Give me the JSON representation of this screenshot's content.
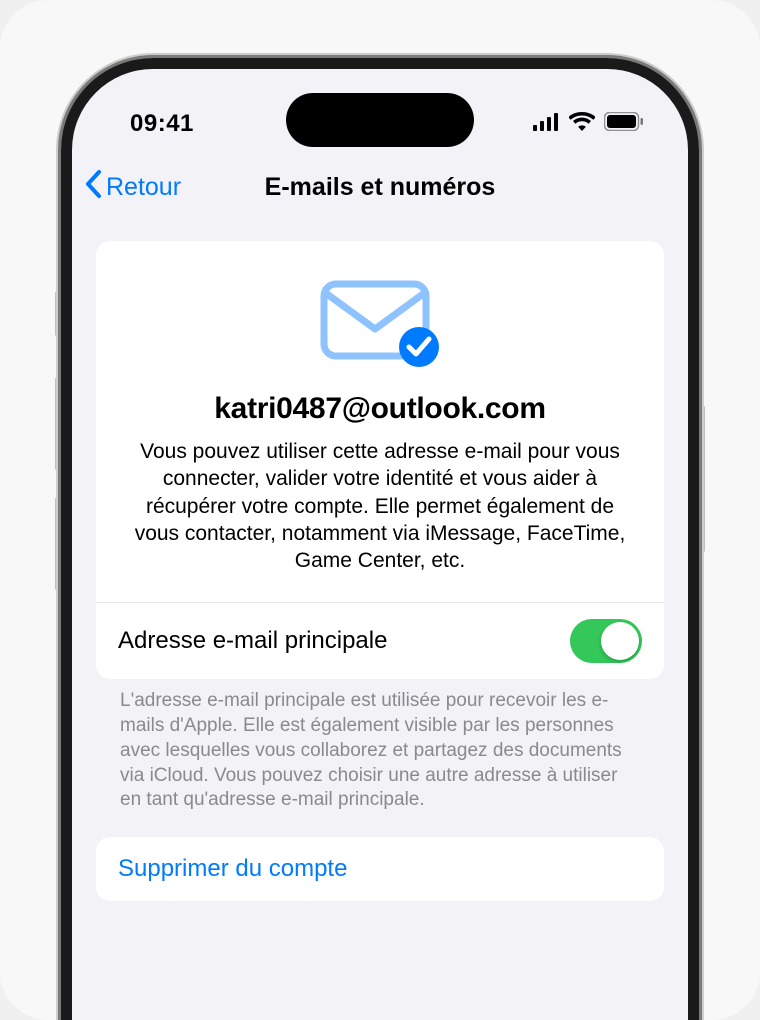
{
  "status": {
    "time": "09:41"
  },
  "nav": {
    "back_label": "Retour",
    "title": "E-mails et numéros"
  },
  "hero": {
    "email": "katri0487@outlook.com",
    "description": "Vous pouvez utiliser cette adresse e-mail pour vous connecter, valider votre identité et vous aider à récupérer votre compte. Elle permet également de vous contacter, notamment via iMessage, FaceTime, Game Center, etc."
  },
  "primary": {
    "label": "Adresse e-mail principale",
    "enabled": true,
    "footer": "L'adresse e-mail principale est utilisée pour recevoir les e-mails d'Apple. Elle est également visible par les personnes avec lesquelles vous collaborez et partagez des documents via iCloud. Vous pouvez choisir une autre adresse à utiliser en tant qu'adresse e-mail principale."
  },
  "remove": {
    "label": "Supprimer du compte"
  },
  "colors": {
    "accent": "#007aff",
    "switch_on": "#34c759",
    "bg": "#f2f2f7"
  }
}
